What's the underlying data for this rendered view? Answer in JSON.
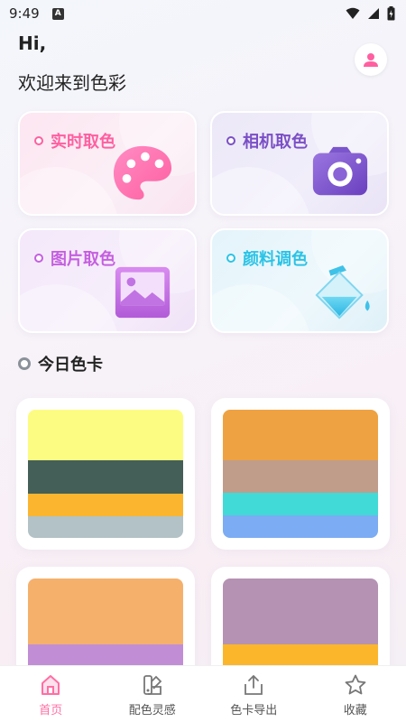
{
  "status_bar": {
    "time": "9:49",
    "notif_letter": "A"
  },
  "header": {
    "hi": "Hi,",
    "welcome": "欢迎来到色彩"
  },
  "tools": [
    {
      "label": "实时取色",
      "color": "#ff5fa0",
      "icon": "palette-icon"
    },
    {
      "label": "相机取色",
      "color": "#7b4fc6",
      "icon": "camera-icon"
    },
    {
      "label": "图片取色",
      "color": "#c55fe0",
      "icon": "image-icon"
    },
    {
      "label": "颜料调色",
      "color": "#2cc3e6",
      "icon": "paint-bucket-icon"
    }
  ],
  "section": {
    "title": "今日色卡"
  },
  "palettes": [
    {
      "colors": [
        "#fdfc82",
        "#435f57",
        "#fbb52e",
        "#b2c2c6"
      ],
      "weights": [
        1.55,
        1,
        0.7,
        0.65
      ]
    },
    {
      "colors": [
        "#eea241",
        "#c09d8a",
        "#41dad7",
        "#7cacf3"
      ],
      "weights": [
        1.55,
        1,
        0.7,
        0.7
      ]
    },
    {
      "colors": [
        "#f5b06c",
        "#c18ed5",
        "#f2aa68"
      ],
      "weights": [
        1.55,
        1,
        0.1
      ]
    },
    {
      "colors": [
        "#b592b3",
        "#fbb62c",
        "#f4c58c"
      ],
      "weights": [
        1.55,
        1,
        0.1
      ]
    }
  ],
  "nav": [
    {
      "label": "首页",
      "icon": "home-icon",
      "active": true
    },
    {
      "label": "配色灵感",
      "icon": "palette-swatch-icon",
      "active": false
    },
    {
      "label": "色卡导出",
      "icon": "export-icon",
      "active": false
    },
    {
      "label": "收藏",
      "icon": "star-icon",
      "active": false
    }
  ],
  "colors": {
    "accent": "#ff6fa3",
    "avatar": "#ff5fa0"
  }
}
